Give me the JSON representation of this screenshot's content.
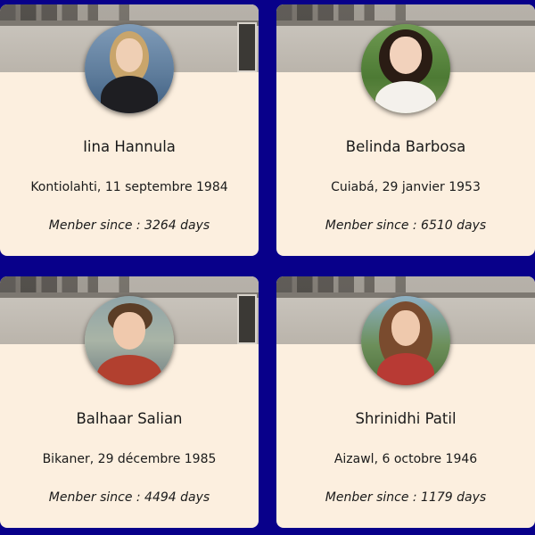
{
  "cards": [
    {
      "name": "Iina Hannula",
      "origin": "Kontiolahti, 11 septembre 1984",
      "member": "Menber since : 3264 days"
    },
    {
      "name": "Belinda Barbosa",
      "origin": "Cuiabá, 29 janvier 1953",
      "member": "Menber since : 6510 days"
    },
    {
      "name": "Balhaar Salian",
      "origin": "Bikaner, 29 décembre 1985",
      "member": "Menber since : 4494 days"
    },
    {
      "name": "Shrinidhi Patil",
      "origin": "Aizawl, 6 octobre 1946",
      "member": "Menber since : 1179 days"
    }
  ],
  "colors": {
    "page_background": "#08008a",
    "card_background": "#fcefdf"
  }
}
